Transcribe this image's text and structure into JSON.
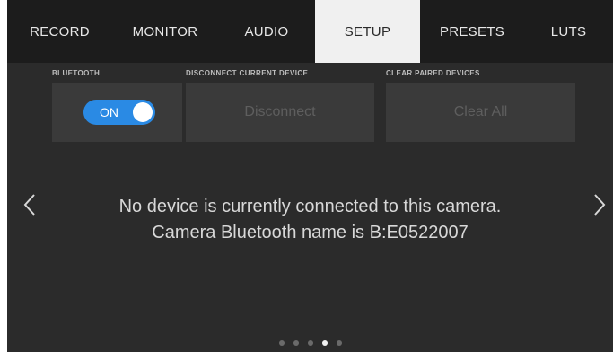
{
  "tabs": [
    {
      "label": "RECORD"
    },
    {
      "label": "MONITOR"
    },
    {
      "label": "AUDIO"
    },
    {
      "label": "SETUP",
      "active": true
    },
    {
      "label": "PRESETS"
    },
    {
      "label": "LUTS"
    }
  ],
  "bluetooth": {
    "section_label": "BLUETOOTH",
    "toggle_label": "ON",
    "toggle_color": "#2a8ae4"
  },
  "disconnect": {
    "section_label": "DISCONNECT CURRENT DEVICE",
    "button_label": "Disconnect"
  },
  "clear": {
    "section_label": "CLEAR PAIRED DEVICES",
    "button_label": "Clear All"
  },
  "message": {
    "line1": "No device is currently connected to this camera.",
    "line2": "Camera Bluetooth name is B:E0522007"
  },
  "navigation": {
    "prev_icon": "chevron-left-icon",
    "next_icon": "chevron-right-icon"
  },
  "pagination": {
    "total_pages": 5,
    "current_page": 4
  }
}
